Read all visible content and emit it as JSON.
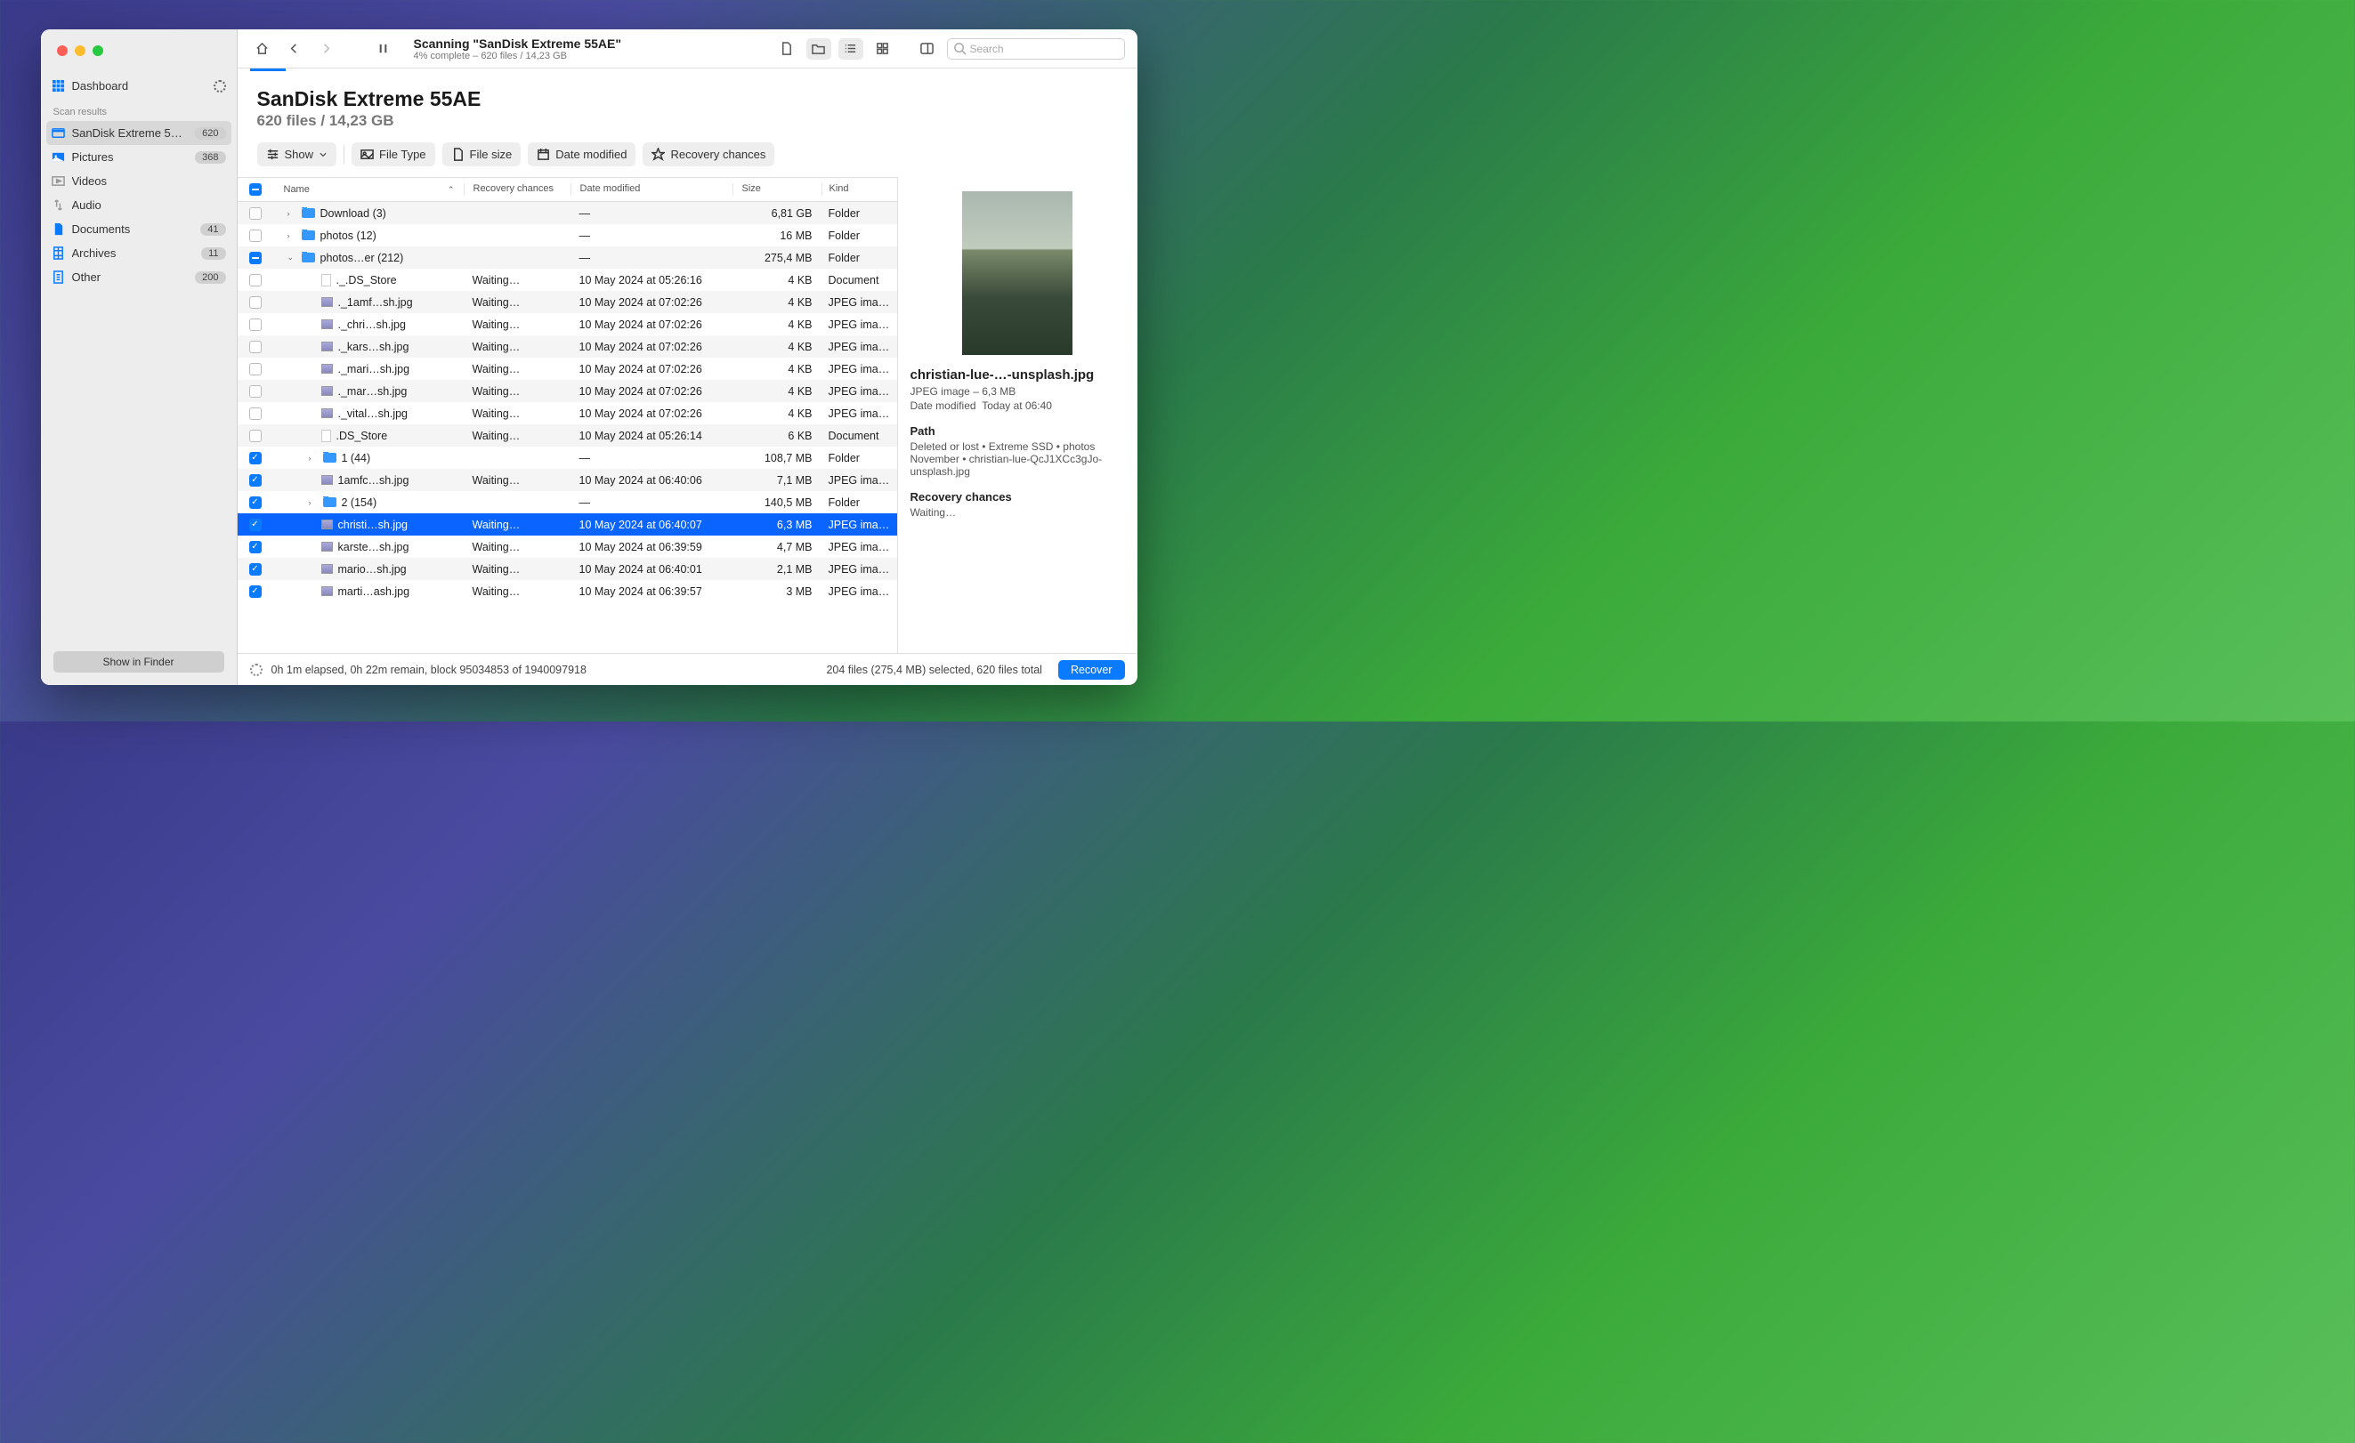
{
  "toolbar": {
    "title": "Scanning \"SanDisk Extreme 55AE\"",
    "subtitle": "4% complete – 620 files / 14,23 GB",
    "search_placeholder": "Search"
  },
  "sidebar": {
    "dashboard": "Dashboard",
    "section": "Scan results",
    "items": [
      {
        "label": "SanDisk Extreme 5…",
        "badge": "620"
      },
      {
        "label": "Pictures",
        "badge": "368"
      },
      {
        "label": "Videos",
        "badge": ""
      },
      {
        "label": "Audio",
        "badge": ""
      },
      {
        "label": "Documents",
        "badge": "41"
      },
      {
        "label": "Archives",
        "badge": "11"
      },
      {
        "label": "Other",
        "badge": "200"
      }
    ],
    "finder": "Show in Finder"
  },
  "header": {
    "title": "SanDisk Extreme 55AE",
    "subtitle": "620 files / 14,23 GB"
  },
  "filters": {
    "show": "Show",
    "filetype": "File Type",
    "filesize": "File size",
    "datemod": "Date modified",
    "recovery": "Recovery chances"
  },
  "columns": {
    "name": "Name",
    "recovery": "Recovery chances",
    "date": "Date modified",
    "size": "Size",
    "kind": "Kind"
  },
  "rows": [
    {
      "i": 0,
      "cb": "",
      "d": ">",
      "type": "folder",
      "name": "Download (3)",
      "rec": "",
      "date": "—",
      "size": "6,81 GB",
      "kind": "Folder",
      "alt": true
    },
    {
      "i": 0,
      "cb": "",
      "d": ">",
      "type": "folder",
      "name": "photos (12)",
      "rec": "",
      "date": "—",
      "size": "16 MB",
      "kind": "Folder"
    },
    {
      "i": 0,
      "cb": "ind",
      "d": "v",
      "type": "folder",
      "name": "photos…er (212)",
      "rec": "",
      "date": "—",
      "size": "275,4 MB",
      "kind": "Folder",
      "alt": true
    },
    {
      "i": 1,
      "cb": "",
      "d": "",
      "type": "doc",
      "name": "._.DS_Store",
      "rec": "Waiting…",
      "date": "10 May 2024 at 05:26:16",
      "size": "4 KB",
      "kind": "Document"
    },
    {
      "i": 1,
      "cb": "",
      "d": "",
      "type": "img",
      "name": "._1amf…sh.jpg",
      "rec": "Waiting…",
      "date": "10 May 2024 at 07:02:26",
      "size": "4 KB",
      "kind": "JPEG ima…",
      "alt": true
    },
    {
      "i": 1,
      "cb": "",
      "d": "",
      "type": "img",
      "name": "._chri…sh.jpg",
      "rec": "Waiting…",
      "date": "10 May 2024 at 07:02:26",
      "size": "4 KB",
      "kind": "JPEG ima…"
    },
    {
      "i": 1,
      "cb": "",
      "d": "",
      "type": "img",
      "name": "._kars…sh.jpg",
      "rec": "Waiting…",
      "date": "10 May 2024 at 07:02:26",
      "size": "4 KB",
      "kind": "JPEG ima…",
      "alt": true
    },
    {
      "i": 1,
      "cb": "",
      "d": "",
      "type": "img",
      "name": "._mari…sh.jpg",
      "rec": "Waiting…",
      "date": "10 May 2024 at 07:02:26",
      "size": "4 KB",
      "kind": "JPEG ima…"
    },
    {
      "i": 1,
      "cb": "",
      "d": "",
      "type": "img",
      "name": "._mar…sh.jpg",
      "rec": "Waiting…",
      "date": "10 May 2024 at 07:02:26",
      "size": "4 KB",
      "kind": "JPEG ima…",
      "alt": true
    },
    {
      "i": 1,
      "cb": "",
      "d": "",
      "type": "img",
      "name": "._vital…sh.jpg",
      "rec": "Waiting…",
      "date": "10 May 2024 at 07:02:26",
      "size": "4 KB",
      "kind": "JPEG ima…"
    },
    {
      "i": 1,
      "cb": "",
      "d": "",
      "type": "doc",
      "name": ".DS_Store",
      "rec": "Waiting…",
      "date": "10 May 2024 at 05:26:14",
      "size": "6 KB",
      "kind": "Document",
      "alt": true
    },
    {
      "i": 1,
      "cb": "chk",
      "d": ">",
      "type": "folder",
      "name": "1 (44)",
      "rec": "",
      "date": "—",
      "size": "108,7 MB",
      "kind": "Folder"
    },
    {
      "i": 1,
      "cb": "chk",
      "d": "",
      "type": "img",
      "name": "1amfc…sh.jpg",
      "rec": "Waiting…",
      "date": "10 May 2024 at 06:40:06",
      "size": "7,1 MB",
      "kind": "JPEG ima…",
      "alt": true
    },
    {
      "i": 1,
      "cb": "chk",
      "d": ">",
      "type": "folder",
      "name": "2 (154)",
      "rec": "",
      "date": "—",
      "size": "140,5 MB",
      "kind": "Folder"
    },
    {
      "i": 1,
      "cb": "chk",
      "d": "",
      "type": "img",
      "name": "christi…sh.jpg",
      "rec": "Waiting…",
      "date": "10 May 2024 at 06:40:07",
      "size": "6,3 MB",
      "kind": "JPEG ima…",
      "sel": true
    },
    {
      "i": 1,
      "cb": "chk",
      "d": "",
      "type": "img",
      "name": "karste…sh.jpg",
      "rec": "Waiting…",
      "date": "10 May 2024 at 06:39:59",
      "size": "4,7 MB",
      "kind": "JPEG ima…"
    },
    {
      "i": 1,
      "cb": "chk",
      "d": "",
      "type": "img",
      "name": "mario…sh.jpg",
      "rec": "Waiting…",
      "date": "10 May 2024 at 06:40:01",
      "size": "2,1 MB",
      "kind": "JPEG ima…",
      "alt": true
    },
    {
      "i": 1,
      "cb": "chk",
      "d": "",
      "type": "img",
      "name": "marti…ash.jpg",
      "rec": "Waiting…",
      "date": "10 May 2024 at 06:39:57",
      "size": "3 MB",
      "kind": "JPEG ima…"
    }
  ],
  "preview": {
    "title": "christian-lue-…-unsplash.jpg",
    "meta1": "JPEG image – 6,3 MB",
    "meta2_label": "Date modified",
    "meta2_val": "Today at 06:40",
    "path_label": "Path",
    "path": "Deleted or lost • Extreme SSD • photos November • christian-lue-QcJ1XCc3gJo-unsplash.jpg",
    "rec_label": "Recovery chances",
    "rec_val": "Waiting…"
  },
  "footer": {
    "status": "0h 1m elapsed, 0h 22m remain, block 95034853 of 1940097918",
    "selection": "204 files (275,4 MB) selected, 620 files total",
    "recover": "Recover"
  }
}
